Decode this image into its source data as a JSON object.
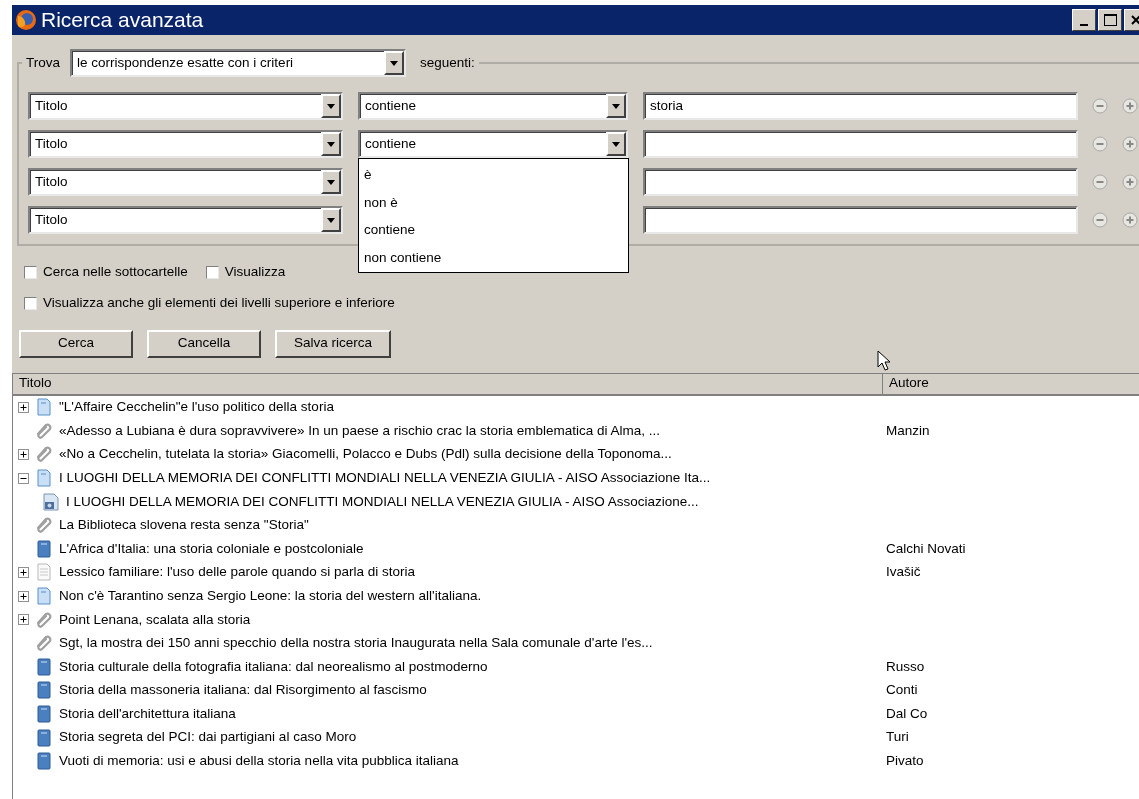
{
  "window": {
    "title": "Ricerca avanzata"
  },
  "match": {
    "label": "Trova",
    "value": "le corrispondenze esatte con i criteri",
    "suffix": "seguenti:"
  },
  "criteria": [
    {
      "field": "Titolo",
      "operator": "contiene",
      "value": "storia"
    },
    {
      "field": "Titolo",
      "operator": "contiene",
      "menu_options": [
        "è",
        "non è",
        "contiene",
        "non contiene"
      ]
    },
    {
      "field": "Titolo"
    },
    {
      "field": "Titolo"
    }
  ],
  "option_lines": [
    [
      {
        "label": "Cerca nelle sottocartelle",
        "checked": false
      },
      {
        "label": "Visualizza",
        "checked": false
      }
    ],
    [
      {
        "label": "Visualizza anche gli elementi dei livelli superiore e inferiore",
        "checked": false
      }
    ]
  ],
  "buttons": [
    "Cerca",
    "Cancella",
    "Salva ricerca"
  ],
  "results": {
    "columns": [
      "Titolo",
      "Autore"
    ],
    "rows": [
      {
        "kind": "document",
        "expanded": false,
        "title": "\"L'Affaire Cecchelin\"e l'uso politico della storia"
      },
      {
        "kind": "clip",
        "title": "«Adesso a Lubiana è dura sopravvivere»   In un paese a rischio crac la storia emblematica di Alma, ...",
        "author": "Manzin"
      },
      {
        "kind": "clip",
        "expanded": false,
        "title": "«No a Cecchelin, tutelata la storia» Giacomelli, Polacco e Dubs (Pdl) sulla decisione della Toponoma..."
      },
      {
        "kind": "document",
        "expanded": true,
        "title": "I LUOGHI DELLA MEMORIA DEI CONFLITTI MONDIALI NELLA VENEZIA GIULIA - AISO Associazione Ita...",
        "children": [
          {
            "kind": "image",
            "title": "I LUOGHI DELLA MEMORIA DEI CONFLITTI MONDIALI NELLA VENEZIA GIULIA - AISO Associazione..."
          }
        ]
      },
      {
        "kind": "clip",
        "title": "La Biblioteca slovena resta senza \"Storia\""
      },
      {
        "kind": "book",
        "title": "L'Africa d'Italia: una storia coloniale e postcoloniale",
        "author": "Calchi Novati"
      },
      {
        "kind": "page",
        "expanded": false,
        "title": "Lessico familiare: l'uso delle parole quando si parla di storia",
        "author": "Ivašič"
      },
      {
        "kind": "document",
        "expanded": false,
        "title": "Non c'è Tarantino senza Sergio Leone: la storia del western all'italiana."
      },
      {
        "kind": "clip",
        "expanded": false,
        "title": "Point Lenana, scalata alla storia"
      },
      {
        "kind": "clip",
        "title": "Sgt, la mostra dei 150 anni specchio della nostra storia   Inaugurata nella Sala comunale d'arte l'es..."
      },
      {
        "kind": "book",
        "title": "Storia culturale della fotografia italiana: dal neorealismo al postmoderno",
        "author": "Russo"
      },
      {
        "kind": "book",
        "title": "Storia della massoneria italiana: dal Risorgimento al fascismo",
        "author": "Conti"
      },
      {
        "kind": "book",
        "title": "Storia dell'architettura italiana",
        "author": "Dal Co"
      },
      {
        "kind": "book",
        "title": "Storia segreta del PCI: dai partigiani al caso Moro",
        "author": "Turi"
      },
      {
        "kind": "book",
        "title": "Vuoti di memoria: usi e abusi della storia nella vita pubblica italiana",
        "author": "Pivato"
      }
    ]
  }
}
